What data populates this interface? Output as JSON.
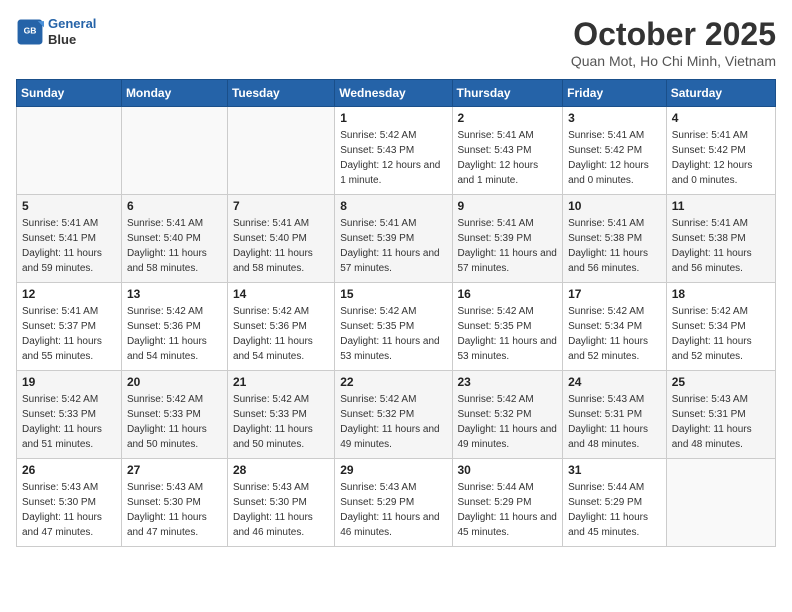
{
  "logo": {
    "line1": "General",
    "line2": "Blue"
  },
  "title": "October 2025",
  "subtitle": "Quan Mot, Ho Chi Minh, Vietnam",
  "days_of_week": [
    "Sunday",
    "Monday",
    "Tuesday",
    "Wednesday",
    "Thursday",
    "Friday",
    "Saturday"
  ],
  "weeks": [
    [
      {
        "day": "",
        "sunrise": "",
        "sunset": "",
        "daylight": ""
      },
      {
        "day": "",
        "sunrise": "",
        "sunset": "",
        "daylight": ""
      },
      {
        "day": "",
        "sunrise": "",
        "sunset": "",
        "daylight": ""
      },
      {
        "day": "1",
        "sunrise": "Sunrise: 5:42 AM",
        "sunset": "Sunset: 5:43 PM",
        "daylight": "Daylight: 12 hours and 1 minute."
      },
      {
        "day": "2",
        "sunrise": "Sunrise: 5:41 AM",
        "sunset": "Sunset: 5:43 PM",
        "daylight": "Daylight: 12 hours and 1 minute."
      },
      {
        "day": "3",
        "sunrise": "Sunrise: 5:41 AM",
        "sunset": "Sunset: 5:42 PM",
        "daylight": "Daylight: 12 hours and 0 minutes."
      },
      {
        "day": "4",
        "sunrise": "Sunrise: 5:41 AM",
        "sunset": "Sunset: 5:42 PM",
        "daylight": "Daylight: 12 hours and 0 minutes."
      }
    ],
    [
      {
        "day": "5",
        "sunrise": "Sunrise: 5:41 AM",
        "sunset": "Sunset: 5:41 PM",
        "daylight": "Daylight: 11 hours and 59 minutes."
      },
      {
        "day": "6",
        "sunrise": "Sunrise: 5:41 AM",
        "sunset": "Sunset: 5:40 PM",
        "daylight": "Daylight: 11 hours and 58 minutes."
      },
      {
        "day": "7",
        "sunrise": "Sunrise: 5:41 AM",
        "sunset": "Sunset: 5:40 PM",
        "daylight": "Daylight: 11 hours and 58 minutes."
      },
      {
        "day": "8",
        "sunrise": "Sunrise: 5:41 AM",
        "sunset": "Sunset: 5:39 PM",
        "daylight": "Daylight: 11 hours and 57 minutes."
      },
      {
        "day": "9",
        "sunrise": "Sunrise: 5:41 AM",
        "sunset": "Sunset: 5:39 PM",
        "daylight": "Daylight: 11 hours and 57 minutes."
      },
      {
        "day": "10",
        "sunrise": "Sunrise: 5:41 AM",
        "sunset": "Sunset: 5:38 PM",
        "daylight": "Daylight: 11 hours and 56 minutes."
      },
      {
        "day": "11",
        "sunrise": "Sunrise: 5:41 AM",
        "sunset": "Sunset: 5:38 PM",
        "daylight": "Daylight: 11 hours and 56 minutes."
      }
    ],
    [
      {
        "day": "12",
        "sunrise": "Sunrise: 5:41 AM",
        "sunset": "Sunset: 5:37 PM",
        "daylight": "Daylight: 11 hours and 55 minutes."
      },
      {
        "day": "13",
        "sunrise": "Sunrise: 5:42 AM",
        "sunset": "Sunset: 5:36 PM",
        "daylight": "Daylight: 11 hours and 54 minutes."
      },
      {
        "day": "14",
        "sunrise": "Sunrise: 5:42 AM",
        "sunset": "Sunset: 5:36 PM",
        "daylight": "Daylight: 11 hours and 54 minutes."
      },
      {
        "day": "15",
        "sunrise": "Sunrise: 5:42 AM",
        "sunset": "Sunset: 5:35 PM",
        "daylight": "Daylight: 11 hours and 53 minutes."
      },
      {
        "day": "16",
        "sunrise": "Sunrise: 5:42 AM",
        "sunset": "Sunset: 5:35 PM",
        "daylight": "Daylight: 11 hours and 53 minutes."
      },
      {
        "day": "17",
        "sunrise": "Sunrise: 5:42 AM",
        "sunset": "Sunset: 5:34 PM",
        "daylight": "Daylight: 11 hours and 52 minutes."
      },
      {
        "day": "18",
        "sunrise": "Sunrise: 5:42 AM",
        "sunset": "Sunset: 5:34 PM",
        "daylight": "Daylight: 11 hours and 52 minutes."
      }
    ],
    [
      {
        "day": "19",
        "sunrise": "Sunrise: 5:42 AM",
        "sunset": "Sunset: 5:33 PM",
        "daylight": "Daylight: 11 hours and 51 minutes."
      },
      {
        "day": "20",
        "sunrise": "Sunrise: 5:42 AM",
        "sunset": "Sunset: 5:33 PM",
        "daylight": "Daylight: 11 hours and 50 minutes."
      },
      {
        "day": "21",
        "sunrise": "Sunrise: 5:42 AM",
        "sunset": "Sunset: 5:33 PM",
        "daylight": "Daylight: 11 hours and 50 minutes."
      },
      {
        "day": "22",
        "sunrise": "Sunrise: 5:42 AM",
        "sunset": "Sunset: 5:32 PM",
        "daylight": "Daylight: 11 hours and 49 minutes."
      },
      {
        "day": "23",
        "sunrise": "Sunrise: 5:42 AM",
        "sunset": "Sunset: 5:32 PM",
        "daylight": "Daylight: 11 hours and 49 minutes."
      },
      {
        "day": "24",
        "sunrise": "Sunrise: 5:43 AM",
        "sunset": "Sunset: 5:31 PM",
        "daylight": "Daylight: 11 hours and 48 minutes."
      },
      {
        "day": "25",
        "sunrise": "Sunrise: 5:43 AM",
        "sunset": "Sunset: 5:31 PM",
        "daylight": "Daylight: 11 hours and 48 minutes."
      }
    ],
    [
      {
        "day": "26",
        "sunrise": "Sunrise: 5:43 AM",
        "sunset": "Sunset: 5:30 PM",
        "daylight": "Daylight: 11 hours and 47 minutes."
      },
      {
        "day": "27",
        "sunrise": "Sunrise: 5:43 AM",
        "sunset": "Sunset: 5:30 PM",
        "daylight": "Daylight: 11 hours and 47 minutes."
      },
      {
        "day": "28",
        "sunrise": "Sunrise: 5:43 AM",
        "sunset": "Sunset: 5:30 PM",
        "daylight": "Daylight: 11 hours and 46 minutes."
      },
      {
        "day": "29",
        "sunrise": "Sunrise: 5:43 AM",
        "sunset": "Sunset: 5:29 PM",
        "daylight": "Daylight: 11 hours and 46 minutes."
      },
      {
        "day": "30",
        "sunrise": "Sunrise: 5:44 AM",
        "sunset": "Sunset: 5:29 PM",
        "daylight": "Daylight: 11 hours and 45 minutes."
      },
      {
        "day": "31",
        "sunrise": "Sunrise: 5:44 AM",
        "sunset": "Sunset: 5:29 PM",
        "daylight": "Daylight: 11 hours and 45 minutes."
      },
      {
        "day": "",
        "sunrise": "",
        "sunset": "",
        "daylight": ""
      }
    ]
  ]
}
